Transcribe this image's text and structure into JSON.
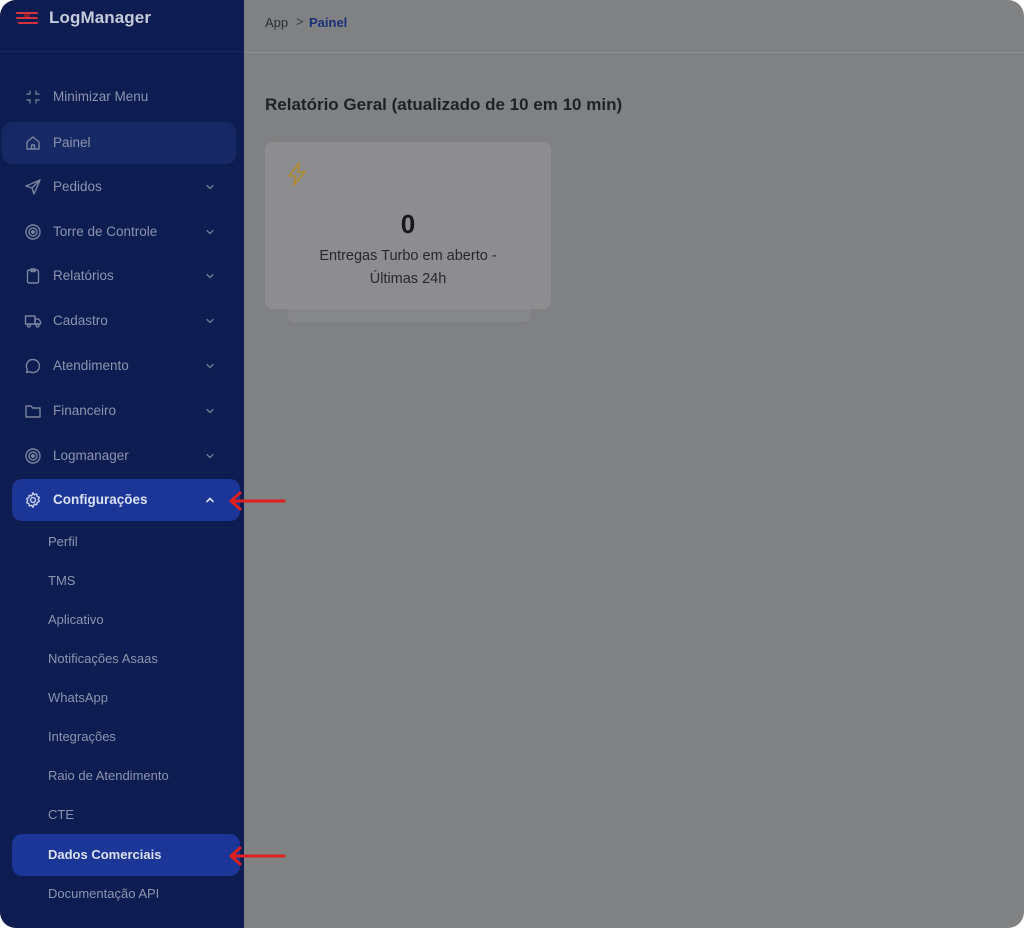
{
  "app": {
    "name": "LogManager"
  },
  "sidebar": {
    "minimize_label": "Minimizar Menu",
    "items": [
      {
        "label": "Painel",
        "icon": "home-icon"
      },
      {
        "label": "Pedidos",
        "icon": "send-icon"
      },
      {
        "label": "Torre de Controle",
        "icon": "target-icon"
      },
      {
        "label": "Relatórios",
        "icon": "clipboard-icon"
      },
      {
        "label": "Cadastro",
        "icon": "truck-icon"
      },
      {
        "label": "Atendimento",
        "icon": "chat-icon"
      },
      {
        "label": "Financeiro",
        "icon": "folder-icon"
      },
      {
        "label": "Logmanager",
        "icon": "target-icon"
      },
      {
        "label": "Configurações",
        "icon": "gear-icon"
      }
    ],
    "submenu": [
      "Perfil",
      "TMS",
      "Aplicativo",
      "Notificações Asaas",
      "WhatsApp",
      "Integrações",
      "Raio de Atendimento",
      "CTE",
      "Dados Comerciais",
      "Documentação API"
    ]
  },
  "breadcrumb": {
    "root": "App",
    "separator": ">",
    "current": "Painel"
  },
  "main": {
    "title": "Relatório Geral (atualizado de 10 em 10 min)",
    "card": {
      "icon": "lightning-icon",
      "value": "0",
      "label_line1": "Entregas Turbo em aberto -",
      "label_line2": "Últimas 24h"
    }
  },
  "colors": {
    "sidebar_bg": "#0d1c51",
    "accent": "#1b3696",
    "overlay": "#808183",
    "annotation_arrow": "#e0201e",
    "lightning": "#b08a2a"
  }
}
